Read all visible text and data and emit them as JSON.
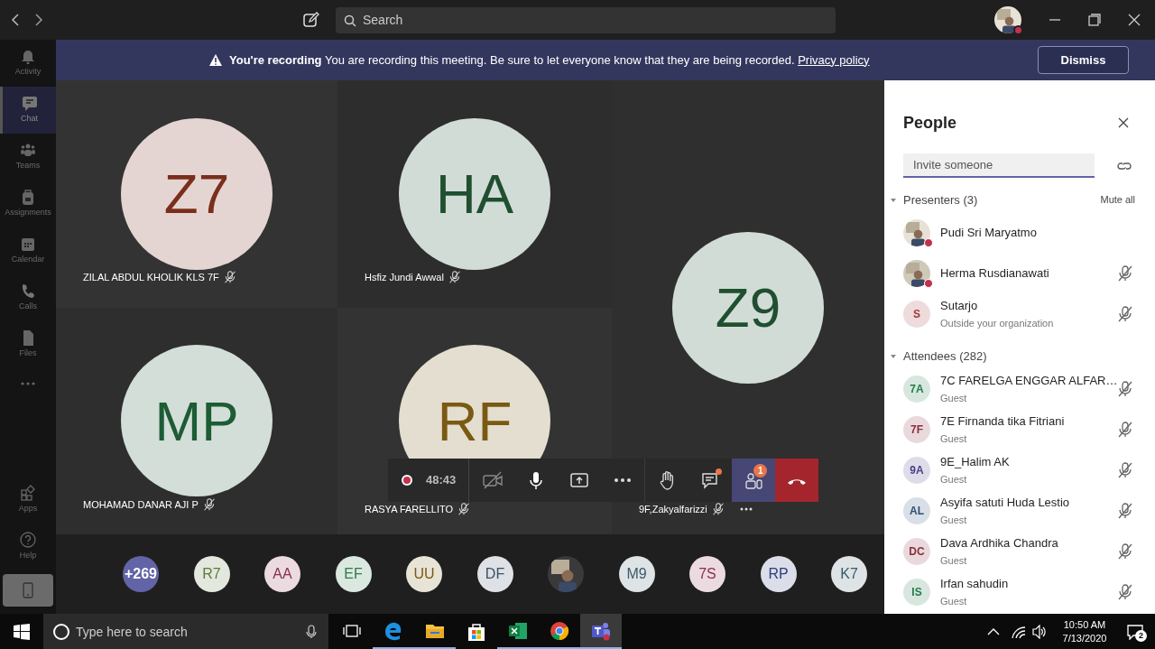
{
  "title_bar": {
    "search_placeholder": "Search"
  },
  "rail": {
    "items": [
      {
        "label": "Activity",
        "selected": false
      },
      {
        "label": "Chat",
        "selected": true
      },
      {
        "label": "Teams",
        "selected": false
      },
      {
        "label": "Assignments",
        "selected": false
      },
      {
        "label": "Calendar",
        "selected": false
      },
      {
        "label": "Calls",
        "selected": false
      },
      {
        "label": "Files",
        "selected": false
      }
    ],
    "bottom_items": [
      {
        "label": "Apps"
      },
      {
        "label": "Help"
      }
    ]
  },
  "banner": {
    "title": "You're recording",
    "message": "You are recording this meeting. Be sure to let everyone know that they are being recorded.",
    "link": "Privacy policy",
    "button": "Dismiss"
  },
  "tiles": [
    {
      "initials": "Z7",
      "name": "ZILAL ABDUL KHOLIK KLS 7F",
      "color": "#7a2e1c",
      "muted": true
    },
    {
      "initials": "HA",
      "name": "Hsfiz Jundi Awwal",
      "color": "#1f4f30",
      "muted": true
    },
    {
      "initials": "MP",
      "name": "MOHAMAD DANAR AJI P",
      "color": "#1d5c35",
      "muted": true
    },
    {
      "initials": "RF",
      "name": "RASYA FARELLITO",
      "color": "#7a5a12",
      "muted": true
    },
    {
      "initials": "Z9",
      "name": "9F,Zakyalfarizzi",
      "color": "#1f4f30",
      "muted": true,
      "more": true
    }
  ],
  "call_controls": {
    "recording": true,
    "timer": "48:43",
    "camera_on": false,
    "chat_unread": true,
    "people_badge": "1",
    "people_selected": true
  },
  "strip": [
    {
      "kind": "overflow",
      "label": "+269"
    },
    {
      "kind": "initials",
      "label": "R7",
      "color": "#5d7a3a"
    },
    {
      "kind": "initials",
      "label": "AA",
      "color": "#8b2e4e"
    },
    {
      "kind": "initials",
      "label": "EF",
      "color": "#2e7a4a"
    },
    {
      "kind": "initials",
      "label": "UU",
      "color": "#7a5a12"
    },
    {
      "kind": "initials",
      "label": "DF",
      "color": "#3a4f66"
    },
    {
      "kind": "picture"
    },
    {
      "kind": "initials",
      "label": "M9",
      "color": "#3a5a6a"
    },
    {
      "kind": "initials",
      "label": "7S",
      "color": "#8b2e4e"
    },
    {
      "kind": "initials",
      "label": "RP",
      "color": "#2e3e7a"
    },
    {
      "kind": "initials",
      "label": "K7",
      "color": "#3a5a6a"
    }
  ],
  "people": {
    "title": "People",
    "invite_placeholder": "Invite someone",
    "groups": [
      {
        "label": "Presenters (3)",
        "expanded": true,
        "action": "Mute all",
        "members": [
          {
            "kind": "picture",
            "name": "Pudi Sri Maryatmo",
            "busy": true,
            "muted": false
          },
          {
            "kind": "picture",
            "name": "Herma Rusdianawati",
            "busy": true,
            "muted": true
          },
          {
            "kind": "initials",
            "initials": "S",
            "color": "#a4373a",
            "name": "Sutarjo",
            "detail": "Outside your organization",
            "muted": true
          }
        ]
      },
      {
        "label": "Attendees (282)",
        "expanded": true,
        "members": [
          {
            "kind": "initials",
            "initials": "7A",
            "color": "#237b4b",
            "name": "7C FARELGA ENGGAR ALFAR…",
            "detail": "Guest",
            "muted": true
          },
          {
            "kind": "initials",
            "initials": "7F",
            "color": "#8b2e3e",
            "name": "7E Firnanda tika Fitriani",
            "detail": "Guest",
            "muted": true
          },
          {
            "kind": "initials",
            "initials": "9A",
            "color": "#4b3f8a",
            "name": "9E_Halim AK",
            "detail": "Guest",
            "muted": true
          },
          {
            "kind": "initials",
            "initials": "AL",
            "color": "#2e4e7a",
            "name": "Asyifa satuti Huda Lestio",
            "detail": "Guest",
            "muted": true
          },
          {
            "kind": "initials",
            "initials": "DC",
            "color": "#8b2e3e",
            "name": "Dava Ardhika Chandra",
            "detail": "Guest",
            "muted": true
          },
          {
            "kind": "initials",
            "initials": "IS",
            "color": "#237b4b",
            "name": "Irfan sahudin",
            "detail": "Guest",
            "muted": true
          }
        ]
      }
    ]
  },
  "taskbar": {
    "search_placeholder": "Type here to search",
    "apps": [
      {
        "selected": false
      },
      {
        "selected": false
      },
      {
        "selected": false
      },
      {
        "selected": false
      },
      {
        "selected": false
      },
      {
        "selected": false
      },
      {
        "selected": true
      }
    ],
    "time": "10:50 AM",
    "date": "7/13/2020",
    "notifications": "2"
  }
}
